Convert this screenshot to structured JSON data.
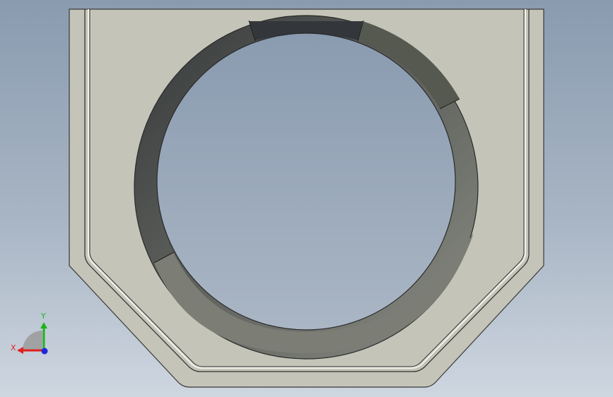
{
  "viewport": {
    "background_top": "#8a9bb0",
    "background_bottom": "#ced6e0"
  },
  "model": {
    "body_color": "#c4c4b8",
    "edge_color": "#3a3a3a",
    "bore_dark": "#3f4240",
    "bore_mid": "#6d7068",
    "bore_light": "#8d8f88"
  },
  "triad": {
    "x_label": "X",
    "y_label": "Y",
    "x_color": "#e0201c",
    "y_color": "#1cb51c",
    "z_color": "#1c2ad8"
  }
}
